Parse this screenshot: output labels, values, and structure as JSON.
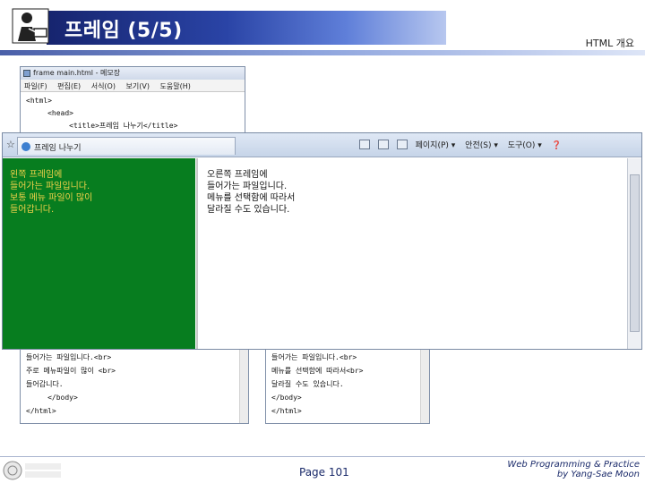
{
  "slide": {
    "title": "프레임 (5/5)",
    "section": "HTML 개요",
    "page": "Page 101",
    "credit_line1": "Web Programming & Practice",
    "credit_line2": "by Yang-Sae Moon"
  },
  "notepad_top": {
    "title": "frame main.html - 메모장",
    "menu": [
      "파일(F)",
      "편집(E)",
      "서식(O)",
      "보기(V)",
      "도움말(H)"
    ],
    "lines": [
      "<html>",
      "     <head>",
      "          <title>프레임 나누기</title>"
    ]
  },
  "ie": {
    "tab_title": "프레임 나누기",
    "tools": [
      "페이지(P) ▾",
      "안전(S) ▾",
      "도구(O) ▾"
    ],
    "left_frame_lines": [
      "왼쪽 프레임에",
      "들어가는 파일입니다.",
      "보통 메뉴 파일이 많이",
      "들어갑니다."
    ],
    "right_frame_lines": [
      "오른쪽 프레임에",
      "들어가는 파일입니다.",
      "메뉴를 선택함에 따라서",
      "달라질 수도 있습니다."
    ]
  },
  "notepad_left": {
    "lines": [
      "들어가는 파일입니다.<br>",
      "주로 메뉴파일이 많이 <br>",
      "들어갑니다.",
      "     </body>",
      "</html>"
    ]
  },
  "notepad_right": {
    "lines": [
      "들어가는 파일입니다.<br>",
      "메뉴를 선택함에 따라서<br>",
      "달라질 수도 있습니다.",
      "</body>",
      "</html>"
    ]
  },
  "colors": {
    "left_frame_bg": "#077d1f",
    "left_frame_text": "#f1d24a",
    "title_gradient_start": "#16246e"
  }
}
